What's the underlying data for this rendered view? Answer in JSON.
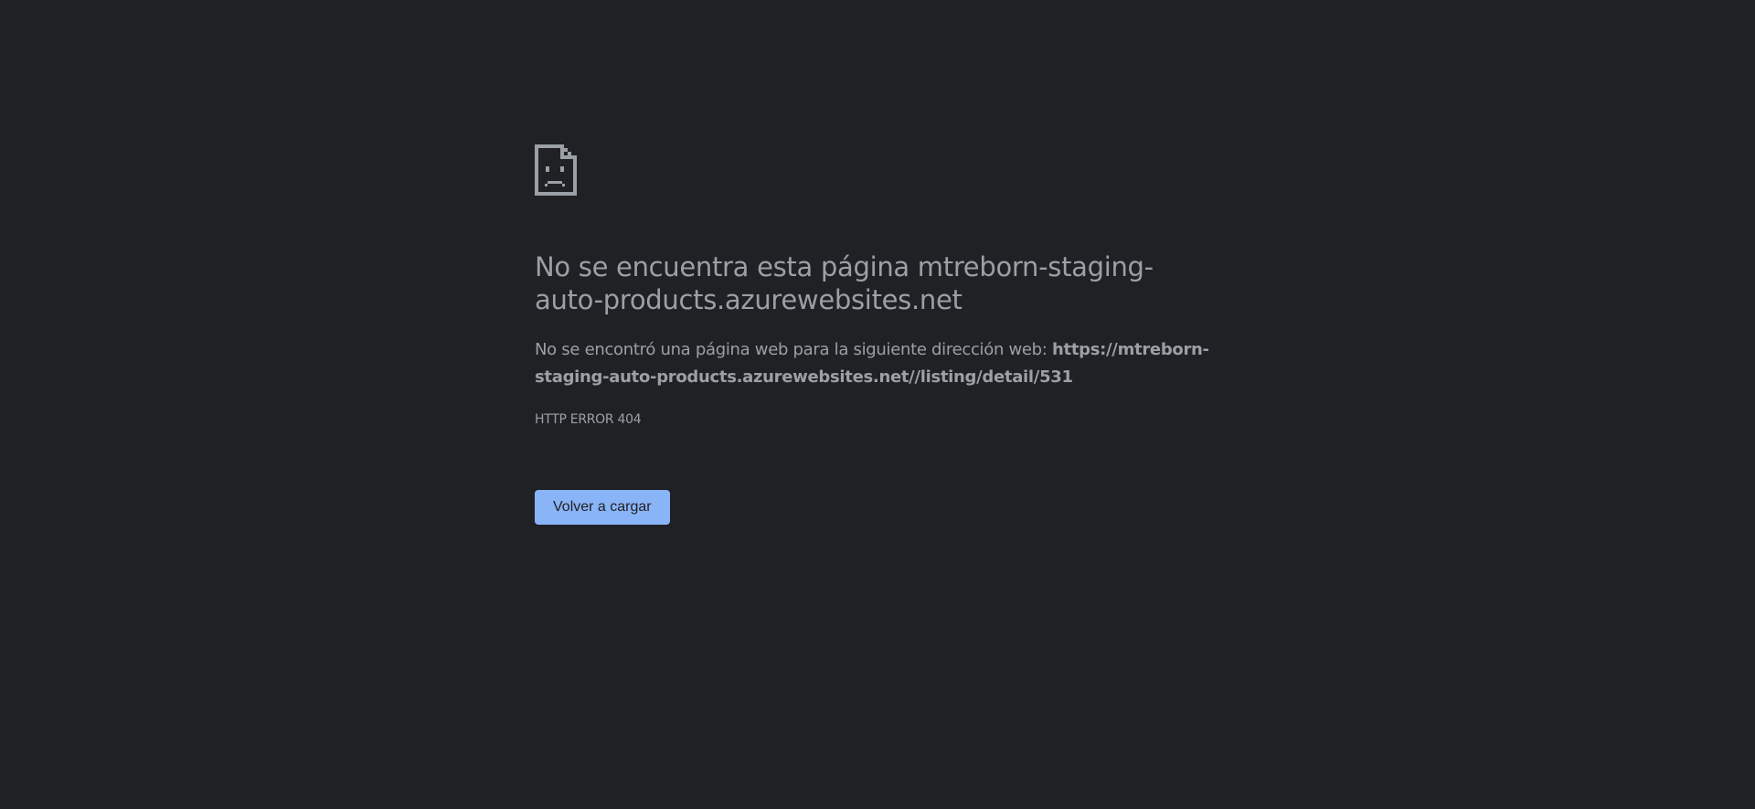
{
  "error_page": {
    "icon": "sad-page-icon",
    "title": "No se encuentra esta página mtreborn-staging-auto-products.azurewebsites.net",
    "description_prefix": "No se encontró una página web para la siguiente dirección web: ",
    "url": "https://mtreborn-staging-auto-products.azurewebsites.net//listing/detail/531",
    "error_code": "HTTP ERROR 404",
    "reload_label": "Volver a cargar"
  },
  "colors": {
    "background": "#202124",
    "text": "#9aa0a6",
    "button": "#8ab4f8",
    "button_text": "#202124"
  }
}
